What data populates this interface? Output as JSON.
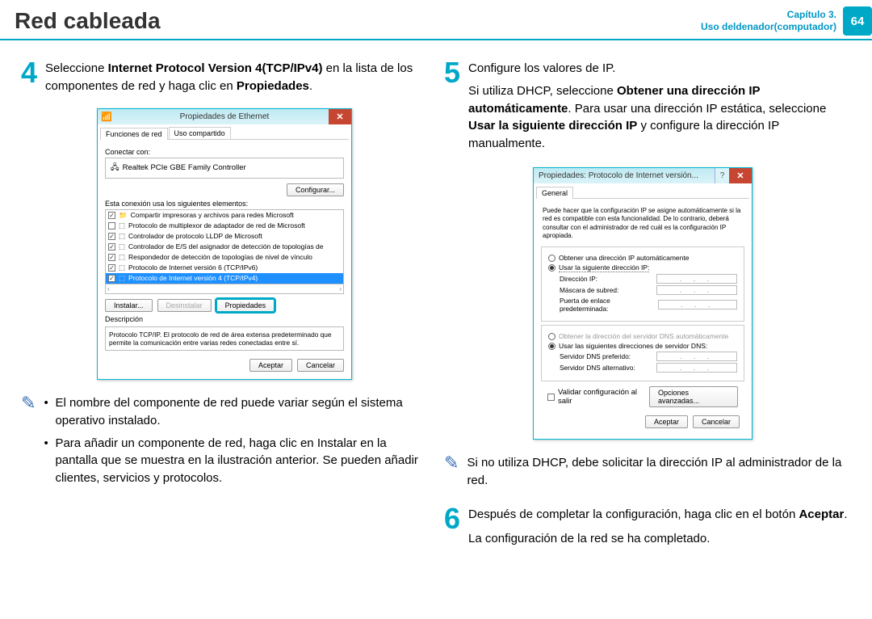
{
  "header": {
    "title": "Red cableada",
    "chapter_line1": "Capítulo 3.",
    "chapter_line2": "Uso deldenador(computador)",
    "page": "64"
  },
  "step4": {
    "num": "4",
    "pre": "Seleccione ",
    "bold1": "Internet Protocol Version 4(TCP/IPv4)",
    "mid": " en la lista de los componentes de red y haga clic en ",
    "bold2": "Propiedades",
    "post": "."
  },
  "win1": {
    "title": "Propiedades de Ethernet",
    "tab1": "Funciones de red",
    "tab2": "Uso compartido",
    "connect_label": "Conectar con:",
    "adapter": "Realtek PCIe GBE Family Controller",
    "configure_btn": "Configurar...",
    "uses_label": "Esta conexión usa los siguientes elementos:",
    "items": [
      "Compartir impresoras y archivos para redes Microsoft",
      "Protocolo de multiplexor de adaptador de red de Microsoft",
      "Controlador de protocolo LLDP de Microsoft",
      "Controlador de E/S del asignador de detección de topologías de",
      "Respondedor de detección de topologías de nivel de vínculo",
      "Protocolo de Internet versión 6 (TCP/IPv6)",
      "Protocolo de Internet versión 4 (TCP/IPv4)"
    ],
    "install_btn": "Instalar...",
    "uninstall_btn": "Desinstalar",
    "props_btn": "Propiedades",
    "desc_label": "Descripción",
    "desc_text": "Protocolo TCP/IP. El protocolo de red de área extensa predeterminado que permite la comunicación entre varias redes conectadas entre sí.",
    "ok_btn": "Aceptar",
    "cancel_btn": "Cancelar"
  },
  "note4": {
    "b1": "El nombre del componente de red puede variar según el sistema operativo instalado.",
    "b2": "Para añadir un componente de red, haga clic en Instalar en la pantalla que se muestra en la ilustración anterior. Se pueden añadir clientes, servicios y protocolos."
  },
  "step5": {
    "num": "5",
    "l1": "Configure los valores de IP.",
    "l2a": "Si utiliza DHCP, seleccione ",
    "l2b": "Obtener una dirección IP automáticamente",
    "l2c": ". Para usar una dirección IP estática, seleccione ",
    "l2d": "Usar la siguiente dirección IP",
    "l2e": " y configure la dirección IP manualmente."
  },
  "win2": {
    "title": "Propiedades: Protocolo de Internet versión...",
    "tab": "General",
    "info": "Puede hacer que la configuración IP se asigne automáticamente si la red es compatible con esta funcionalidad. De lo contrario, deberá consultar con el administrador de red cuál es la configuración IP apropiada.",
    "r1": "Obtener una dirección IP automáticamente",
    "r2": "Usar la siguiente dirección IP:",
    "ip_label": "Dirección IP:",
    "mask_label": "Máscara de subred:",
    "gw_label": "Puerta de enlace predeterminada:",
    "r3": "Obtener la dirección del servidor DNS automáticamente",
    "r4": "Usar las siguientes direcciones de servidor DNS:",
    "dns1": "Servidor DNS preferido:",
    "dns2": "Servidor DNS alternativo:",
    "validate": "Validar configuración al salir",
    "adv_btn": "Opciones avanzadas...",
    "ok_btn": "Aceptar",
    "cancel_btn": "Cancelar"
  },
  "note5": "Si no utiliza DHCP, debe solicitar la dirección IP al administrador de la red.",
  "step6": {
    "num": "6",
    "l1a": "Después de completar la configuración, haga clic en el botón ",
    "l1b": "Aceptar",
    "l1c": ".",
    "l2": "La configuración de la red se ha completado."
  }
}
